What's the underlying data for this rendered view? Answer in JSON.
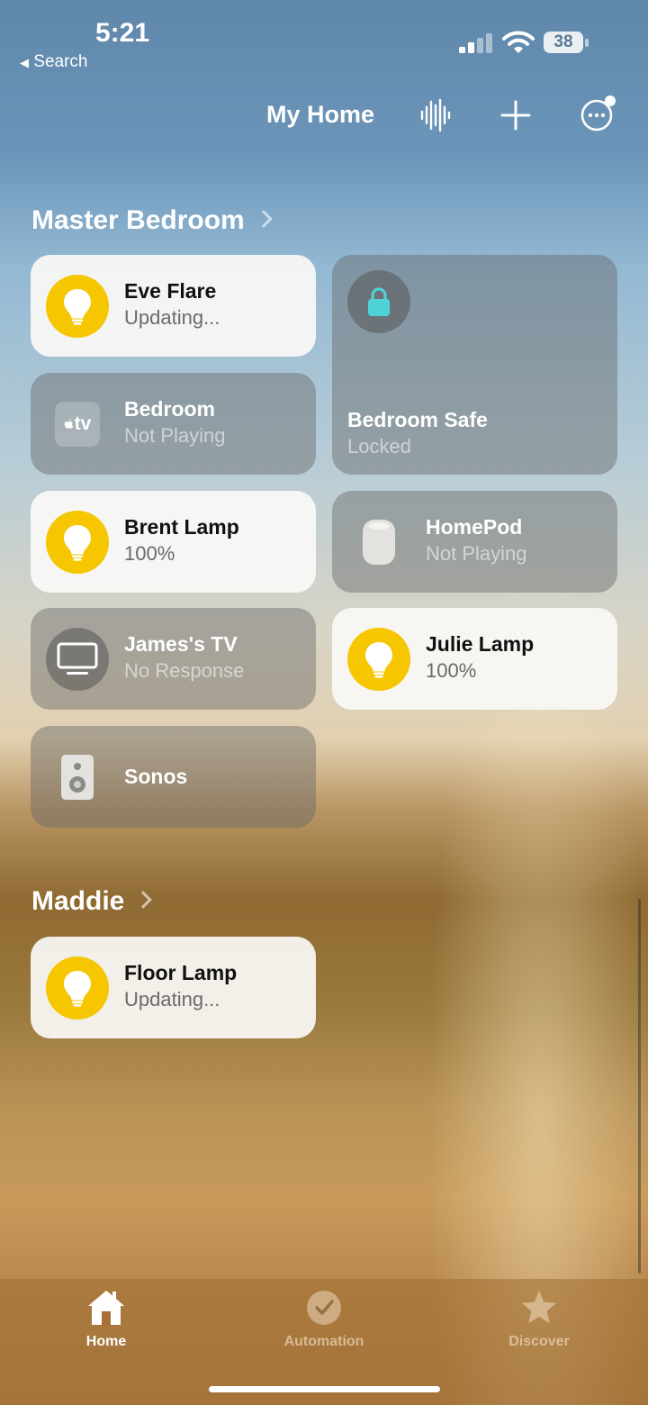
{
  "status_bar": {
    "time": "5:21",
    "back_label": "Search",
    "battery": "38"
  },
  "nav": {
    "title": "My Home",
    "icons": [
      "voice-waveform-icon",
      "plus-icon",
      "more-icon"
    ]
  },
  "sections": [
    {
      "title": "Master Bedroom",
      "tiles": [
        {
          "name": "Eve Flare",
          "status": "Updating...",
          "icon": "lightbulb-icon",
          "style": "on"
        },
        {
          "name": "Bedroom Safe",
          "status": "Locked",
          "icon": "lock-icon",
          "style": "off"
        },
        {
          "name": "Bedroom",
          "status": "Not Playing",
          "icon": "apple-tv-icon",
          "style": "off"
        },
        {
          "name": "Brent Lamp",
          "status": "100%",
          "icon": "lightbulb-icon",
          "style": "on"
        },
        {
          "name": "HomePod",
          "status": "Not Playing",
          "icon": "homepod-icon",
          "style": "off"
        },
        {
          "name": "James's TV",
          "status": "No Response",
          "icon": "tv-icon",
          "style": "off"
        },
        {
          "name": "Julie Lamp",
          "status": "100%",
          "icon": "lightbulb-icon",
          "style": "on"
        },
        {
          "name": "Sonos",
          "status": "",
          "icon": "speaker-icon",
          "style": "off"
        }
      ]
    },
    {
      "title": "Maddie",
      "tiles": [
        {
          "name": "Floor Lamp",
          "status": "Updating...",
          "icon": "lightbulb-icon",
          "style": "on"
        }
      ]
    }
  ],
  "tabs": [
    {
      "label": "Home",
      "icon": "house-icon",
      "selected": true
    },
    {
      "label": "Automation",
      "icon": "automation-icon",
      "selected": false
    },
    {
      "label": "Discover",
      "icon": "star-icon",
      "selected": false
    }
  ],
  "colors": {
    "bulb_on": "#f6c600",
    "lock_accent": "#4fd2d6"
  }
}
